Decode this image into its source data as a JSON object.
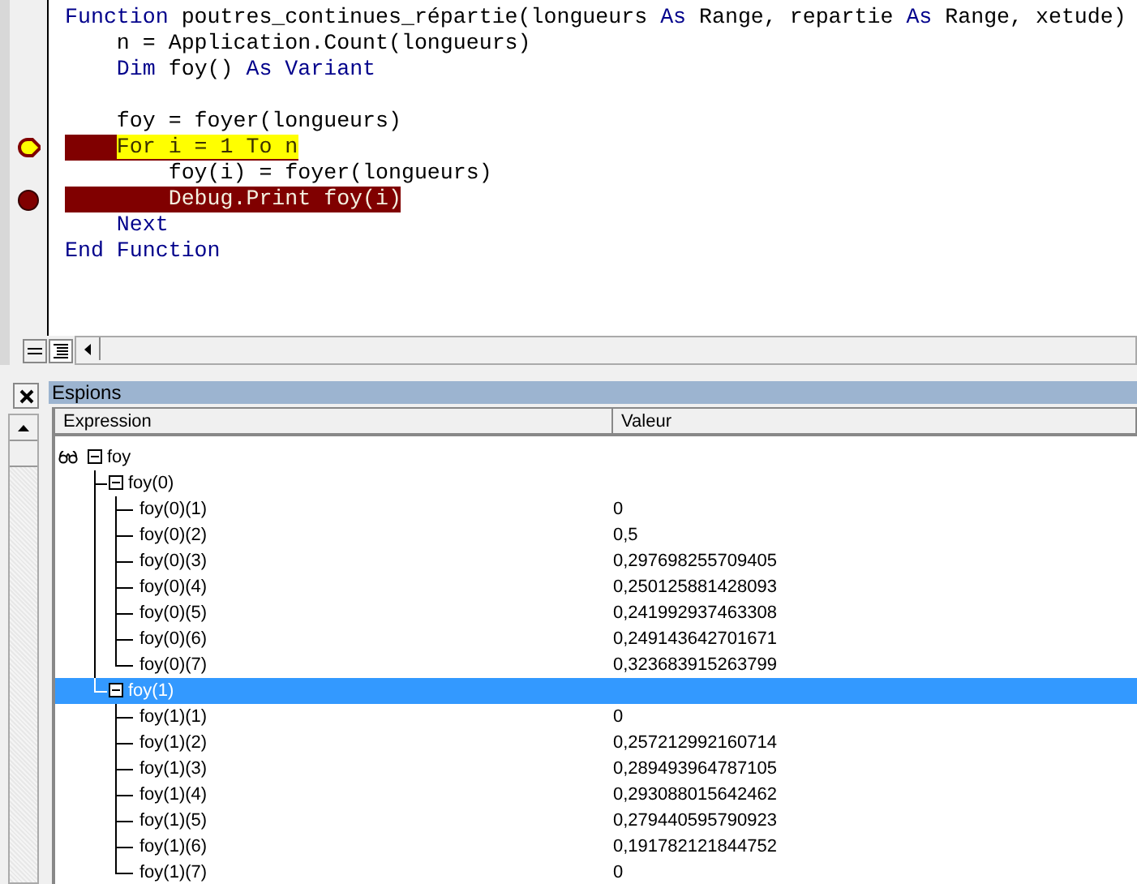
{
  "code": {
    "lines": [
      {
        "tokens": [
          {
            "text": "Function",
            "kind": "keyword"
          },
          {
            "text": " poutres_continues_répartie(longueurs ",
            "kind": "plain"
          },
          {
            "text": "As",
            "kind": "keyword"
          },
          {
            "text": " Range, repartie ",
            "kind": "plain"
          },
          {
            "text": "As",
            "kind": "keyword"
          },
          {
            "text": " Range, xetude)",
            "kind": "plain"
          }
        ],
        "breakpoint": false,
        "current": false
      },
      {
        "tokens": [
          {
            "text": "    n = Application.Count(longueurs)",
            "kind": "plain"
          }
        ],
        "breakpoint": false,
        "current": false
      },
      {
        "tokens": [
          {
            "text": "    Dim",
            "kind": "keyword"
          },
          {
            "text": " foy() ",
            "kind": "plain"
          },
          {
            "text": "As Variant",
            "kind": "keyword"
          }
        ],
        "breakpoint": false,
        "current": false
      },
      {
        "kind": "blank"
      },
      {
        "tokens": [
          {
            "text": "    foy = foyer(longueurs)",
            "kind": "plain"
          }
        ],
        "breakpoint": false,
        "current": false
      },
      {
        "tokens": [
          {
            "text": "    For i = 1 To n",
            "kind": "plain"
          }
        ],
        "breakpoint": true,
        "current": true
      },
      {
        "tokens": [
          {
            "text": "        foy(i) = foyer(longueurs)",
            "kind": "plain"
          }
        ],
        "breakpoint": false,
        "current": false
      },
      {
        "tokens": [
          {
            "text": "        Debug.Print foy(i)",
            "kind": "plain"
          }
        ],
        "breakpoint": true,
        "current": false
      },
      {
        "tokens": [
          {
            "text": "    Next",
            "kind": "keyword"
          }
        ],
        "breakpoint": false,
        "current": false
      },
      {
        "tokens": [
          {
            "text": "End Function",
            "kind": "keyword"
          }
        ],
        "breakpoint": false,
        "current": false
      }
    ]
  },
  "watches": {
    "title": "Espions",
    "columns": [
      "Expression",
      "Valeur"
    ],
    "items": [
      {
        "expression": "foy",
        "expanded": true,
        "selected": false,
        "children": [
          {
            "expression": "foy(0)",
            "expanded": true,
            "selected": false,
            "children": [
              {
                "expression": "foy(0)(1)",
                "value": "0",
                "selected": false
              },
              {
                "expression": "foy(0)(2)",
                "value": "0,5",
                "selected": false
              },
              {
                "expression": "foy(0)(3)",
                "value": "0,297698255709405",
                "selected": false
              },
              {
                "expression": "foy(0)(4)",
                "value": "0,250125881428093",
                "selected": false
              },
              {
                "expression": "foy(0)(5)",
                "value": "0,241992937463308",
                "selected": false
              },
              {
                "expression": "foy(0)(6)",
                "value": "0,249143642701671",
                "selected": false
              },
              {
                "expression": "foy(0)(7)",
                "value": "0,323683915263799",
                "selected": false
              }
            ]
          },
          {
            "expression": "foy(1)",
            "expanded": true,
            "selected": true,
            "children": [
              {
                "expression": "foy(1)(1)",
                "value": "0",
                "selected": false
              },
              {
                "expression": "foy(1)(2)",
                "value": "0,257212992160714",
                "selected": false
              },
              {
                "expression": "foy(1)(3)",
                "value": "0,289493964787105",
                "selected": false
              },
              {
                "expression": "foy(1)(4)",
                "value": "0,293088015642462",
                "selected": false
              },
              {
                "expression": "foy(1)(5)",
                "value": "0,279440595790923",
                "selected": false
              },
              {
                "expression": "foy(1)(6)",
                "value": "0,191782121844752",
                "selected": false
              },
              {
                "expression": "foy(1)(7)",
                "value": "0",
                "selected": false
              }
            ]
          }
        ]
      }
    ]
  }
}
